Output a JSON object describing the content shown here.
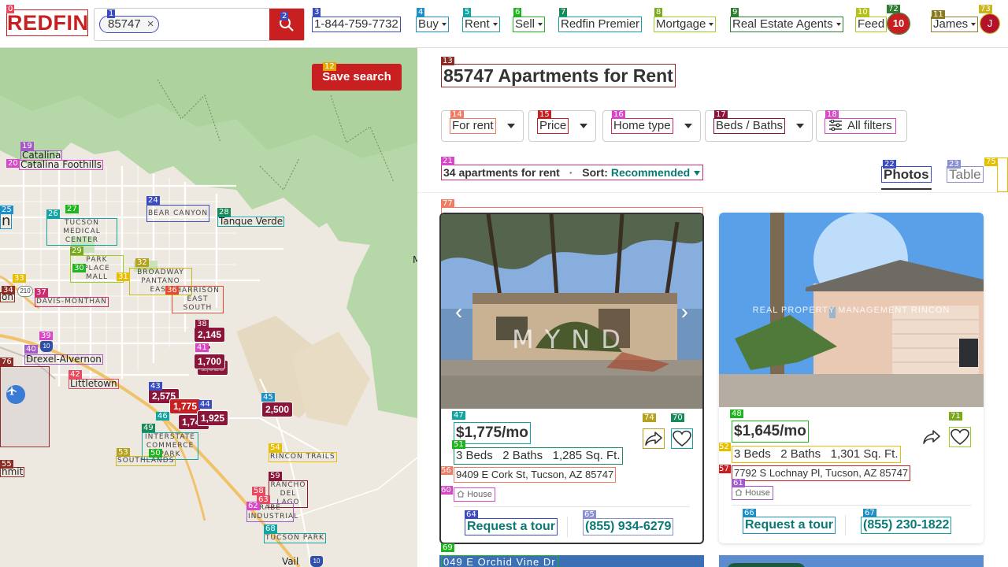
{
  "header": {
    "logo": "REDFIN",
    "search_chip": "85747",
    "chip_remove": "×",
    "phone": "1-844-759-7732",
    "nav": [
      "Buy",
      "Rent",
      "Sell",
      "Redfin Premier",
      "Mortgage",
      "Real Estate Agents"
    ],
    "feed_label": "Feed",
    "feed_count": "10",
    "user_name": "James",
    "user_initial": "J"
  },
  "map": {
    "save_search": "Save search",
    "labels": [
      "Catalina Foothills",
      "Bear Canyon",
      "Tanque Verde",
      "Tucson Medical Center",
      "Park Place Mall",
      "Broadway Pantano East",
      "Harrison East South",
      "Davis-Monthan",
      "Drexel-Alvernon",
      "Littletown",
      "Interstate Commerce Park",
      "Southlands",
      "Rincon Trails",
      "Rancho Del Lago",
      "Rabe Industrial",
      "Tucson Park",
      "Vail"
    ],
    "partial_labels": [
      "n",
      "on",
      "hmit"
    ],
    "road_shields": [
      "210",
      "10",
      "10"
    ],
    "price_pins": [
      "2,145",
      "1,700",
      "2,575",
      "1,775",
      "1,925",
      "2,500",
      "1,925",
      "1,745"
    ],
    "extra_marks": [
      "M"
    ]
  },
  "results": {
    "title": "85747 Apartments for Rent",
    "filters": [
      "For rent",
      "Price",
      "Home type",
      "Beds / Baths"
    ],
    "all_filters": "All filters",
    "count_text": "34 apartments for rent",
    "sort_label": "Sort:",
    "sort_value": "Recommended",
    "view_tabs": [
      "Photos",
      "Table"
    ],
    "listings": [
      {
        "price": "$1,775/mo",
        "beds": "3 Beds",
        "baths": "2 Baths",
        "sqft": "1,285 Sq. Ft.",
        "address": "9409 E Cork St, Tucson, AZ 85747",
        "type": "House",
        "tour": "Request a tour",
        "phone": "(855) 934-6279",
        "watermark": "MYND"
      },
      {
        "price": "$1,645/mo",
        "beds": "3 Beds",
        "baths": "2 Baths",
        "sqft": "1,301 Sq. Ft.",
        "address": "7792 S Lochnay Pl, Tucson, AZ 85747",
        "type": "House",
        "tour": "Request a tour",
        "phone": "(855) 230-1822",
        "watermark": "REAL PROPERTY MANAGEMENT RINCON"
      }
    ],
    "next_card_address": "049 E Orchid Vine Dr"
  },
  "colors": {
    "brand": "#c82021",
    "pin": "#8a1538",
    "link": "#0b7a75"
  }
}
